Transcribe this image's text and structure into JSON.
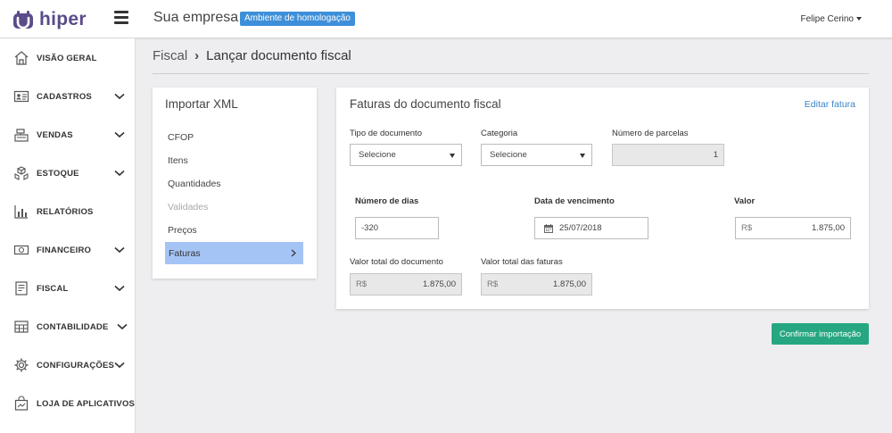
{
  "header": {
    "logo_text": "hiper",
    "company": "Sua empresa",
    "env_badge": "Ambiente de homologação",
    "user": "Felipe Cerino",
    "colors": {
      "brand": "#5b4b8a",
      "badge": "#3d8fd9"
    }
  },
  "sidebar": {
    "items": [
      {
        "label": "VISÃO GERAL",
        "icon": "home-icon"
      },
      {
        "label": "CADASTROS",
        "icon": "id-card-icon"
      },
      {
        "label": "VENDAS",
        "icon": "cash-register-icon"
      },
      {
        "label": "ESTOQUE",
        "icon": "boxes-icon"
      },
      {
        "label": "RELATÓRIOS",
        "icon": "bar-chart-icon"
      },
      {
        "label": "FINANCEIRO",
        "icon": "money-icon"
      },
      {
        "label": "FISCAL",
        "icon": "receipt-icon"
      },
      {
        "label": "CONTABILIDADE",
        "icon": "calculator-icon"
      },
      {
        "label": "CONFIGURAÇÕES",
        "icon": "gear-icon"
      },
      {
        "label": "LOJA DE APLICATIVOS",
        "icon": "shopping-bag-icon"
      }
    ]
  },
  "breadcrumb": {
    "parent": "Fiscal",
    "current": "Lançar documento fiscal"
  },
  "import": {
    "title": "Importar XML",
    "steps": [
      {
        "label": "CFOP"
      },
      {
        "label": "Itens"
      },
      {
        "label": "Quantidades"
      },
      {
        "label": "Validades"
      },
      {
        "label": "Preços"
      },
      {
        "label": "Faturas"
      }
    ]
  },
  "faturas": {
    "title": "Faturas do documento fiscal",
    "edit_link": "Editar fatura",
    "tipo_label": "Tipo de documento",
    "tipo_value": "Selecione",
    "categoria_label": "Categoria",
    "categoria_value": "Selecione",
    "parcelas_label": "Número de parcelas",
    "parcelas_value": "1",
    "dias_label": "Número de dias",
    "dias_value": "-320",
    "vencimento_label": "Data de vencimento",
    "vencimento_value": "25/07/2018",
    "valor_label": "Valor",
    "valor_prefix": "R$",
    "valor_value": "1.875,00",
    "total_doc_label": "Valor total do documento",
    "total_doc_prefix": "R$",
    "total_doc_value": "1.875,00",
    "total_fat_label": "Valor total das faturas",
    "total_fat_prefix": "R$",
    "total_fat_value": "1.875,00"
  },
  "actions": {
    "confirm": "Confirmar importação",
    "confirm_color": "#26a781"
  }
}
